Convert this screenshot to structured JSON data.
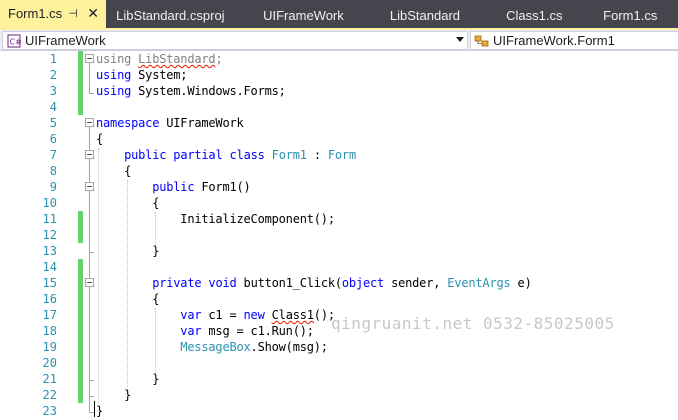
{
  "tabs": [
    {
      "label": "Form1.cs",
      "active": true,
      "pin_glyph": "⊣",
      "close_glyph": "✕"
    },
    {
      "label": "LibStandard.csproj",
      "active": false
    },
    {
      "label": "UIFrameWork",
      "active": false
    },
    {
      "label": "LibStandard",
      "active": false
    },
    {
      "label": "Class1.cs",
      "active": false
    },
    {
      "label": "Form1.cs",
      "active": false
    }
  ],
  "navbar": {
    "project_combo": {
      "value": "UIFrameWork",
      "icon": "csharp-project-icon"
    },
    "type_combo": {
      "value": "UIFrameWork.Form1",
      "icon": "class-icon"
    }
  },
  "editor": {
    "lines": [
      {
        "n": "1"
      },
      {
        "n": "2"
      },
      {
        "n": "3"
      },
      {
        "n": "4"
      },
      {
        "n": "5"
      },
      {
        "n": "6"
      },
      {
        "n": "7"
      },
      {
        "n": "8"
      },
      {
        "n": "9"
      },
      {
        "n": "10"
      },
      {
        "n": "11"
      },
      {
        "n": "12"
      },
      {
        "n": "13"
      },
      {
        "n": "14"
      },
      {
        "n": "15"
      },
      {
        "n": "16"
      },
      {
        "n": "17"
      },
      {
        "n": "18"
      },
      {
        "n": "19"
      },
      {
        "n": "20"
      },
      {
        "n": "21"
      },
      {
        "n": "22"
      },
      {
        "n": "23"
      }
    ],
    "tokens": {
      "l1_using": "using",
      "l1_ns": "LibStandard",
      "l1_semi": ";",
      "l2_using": "using",
      "l2_ns": " System;",
      "l3_using": "using",
      "l3_ns": " System.Windows.Forms;",
      "l5_ns_kw": "namespace",
      "l5_name": " UIFrameWork",
      "l6_brace": "{",
      "l7_public": "public",
      "l7_partial": "partial",
      "l7_class": "class",
      "l7_form1": "Form1",
      "l7_colon": " : ",
      "l7_form": "Form",
      "l8_brace": "{",
      "l9_public": "public",
      "l9_ctor": " Form1()",
      "l10_brace": "{",
      "l11_call": "InitializeComponent();",
      "l13_brace": "}",
      "l15_private": "private",
      "l15_void": "void",
      "l15_name": " button1_Click(",
      "l15_object": "object",
      "l15_sender": " sender, ",
      "l15_eventargs": "EventArgs",
      "l15_e": " e)",
      "l16_brace": "{",
      "l17_var": "var",
      "l17_mid": " c1 = ",
      "l17_new": "new",
      "l17_space": " ",
      "l17_class1": "Class1",
      "l17_end": "();",
      "l18_var": "var",
      "l18_rest": " msg = c1.Run();",
      "l19_mb": "MessageBox",
      "l19_rest": ".Show(msg);",
      "l21_brace": "}",
      "l22_brace": "}",
      "l23_brace": "}"
    },
    "watermark": "qingruanit.net 0532-85025005"
  },
  "colors": {
    "active_tab": "#fff29d",
    "tab_strip": "#45454d",
    "line_number": "#2b91af",
    "keyword": "#0000ff",
    "type": "#2b91af",
    "change_marker": "#6bd06b"
  }
}
